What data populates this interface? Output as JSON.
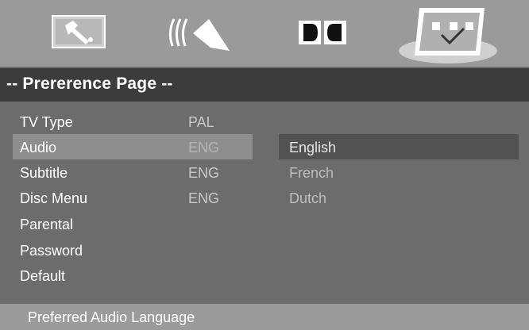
{
  "header": {
    "tabs": [
      {
        "name": "general-setup",
        "icon": "wrench-icon",
        "active": false
      },
      {
        "name": "audio-setup",
        "icon": "speaker-icon",
        "active": false
      },
      {
        "name": "dolby-setup",
        "icon": "dolby-icon",
        "active": false
      },
      {
        "name": "preference-setup",
        "icon": "checkmark-icon",
        "active": true
      }
    ]
  },
  "title": "-- Prererence Page --",
  "menu": {
    "items": [
      {
        "label": "TV Type",
        "value": "PAL"
      },
      {
        "label": "Audio",
        "value": "ENG"
      },
      {
        "label": "Subtitle",
        "value": "ENG"
      },
      {
        "label": "Disc Menu",
        "value": "ENG"
      },
      {
        "label": "Parental",
        "value": ""
      },
      {
        "label": "Password",
        "value": ""
      },
      {
        "label": "Default",
        "value": ""
      }
    ],
    "selected_index": 1
  },
  "options": {
    "items": [
      "English",
      "French",
      "Dutch"
    ],
    "highlighted_index": 0
  },
  "status": "Preferred Audio Language",
  "colors": {
    "background": "#6c6c6c",
    "top_bar": "#9a9a9a",
    "title_bar": "#3c3c3c",
    "selection": "#8e8e8e",
    "option_highlight": "#525252",
    "value_text": "#c9c9c9",
    "option_text": "#bdbdbd",
    "white_text": "#ffffff"
  }
}
